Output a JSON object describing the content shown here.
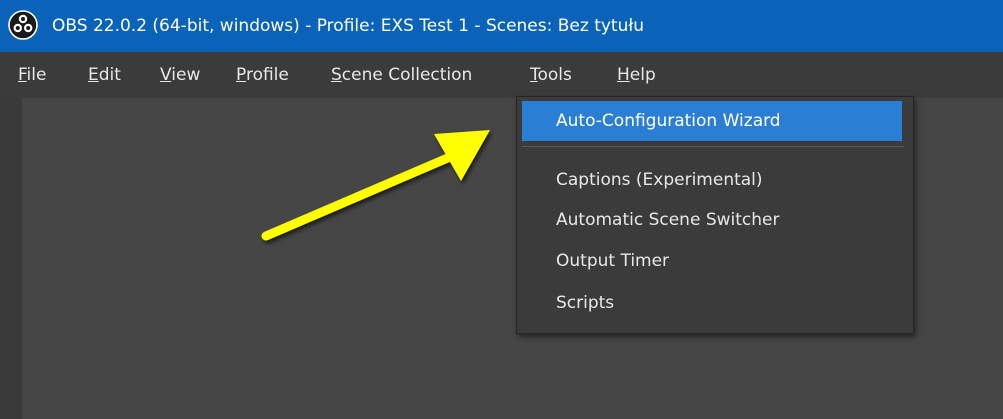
{
  "window": {
    "title": "OBS 22.0.2 (64-bit, windows) - Profile: EXS Test 1 - Scenes: Bez tytułu",
    "icon": "obs-logo-icon",
    "title_bar_color": "#0a63b8"
  },
  "menubar": {
    "items": [
      {
        "mnemonic": "F",
        "rest": "ile"
      },
      {
        "mnemonic": "E",
        "rest": "dit"
      },
      {
        "mnemonic": "V",
        "rest": "iew"
      },
      {
        "mnemonic": "P",
        "rest": "rofile"
      },
      {
        "mnemonic": "S",
        "rest": "cene Collection"
      },
      {
        "mnemonic": "T",
        "rest": "ools"
      },
      {
        "mnemonic": "H",
        "rest": "elp"
      }
    ]
  },
  "tools_menu": {
    "items": [
      {
        "label": "Auto-Configuration Wizard",
        "highlighted": true
      },
      {
        "label": "Captions (Experimental)"
      },
      {
        "label": "Automatic Scene Switcher"
      },
      {
        "label": "Output Timer"
      },
      {
        "label": "Scripts"
      }
    ],
    "highlight_color": "#2a7fd4"
  },
  "annotation": {
    "icon": "yellow-arrow-icon",
    "color": "#ffff00"
  }
}
